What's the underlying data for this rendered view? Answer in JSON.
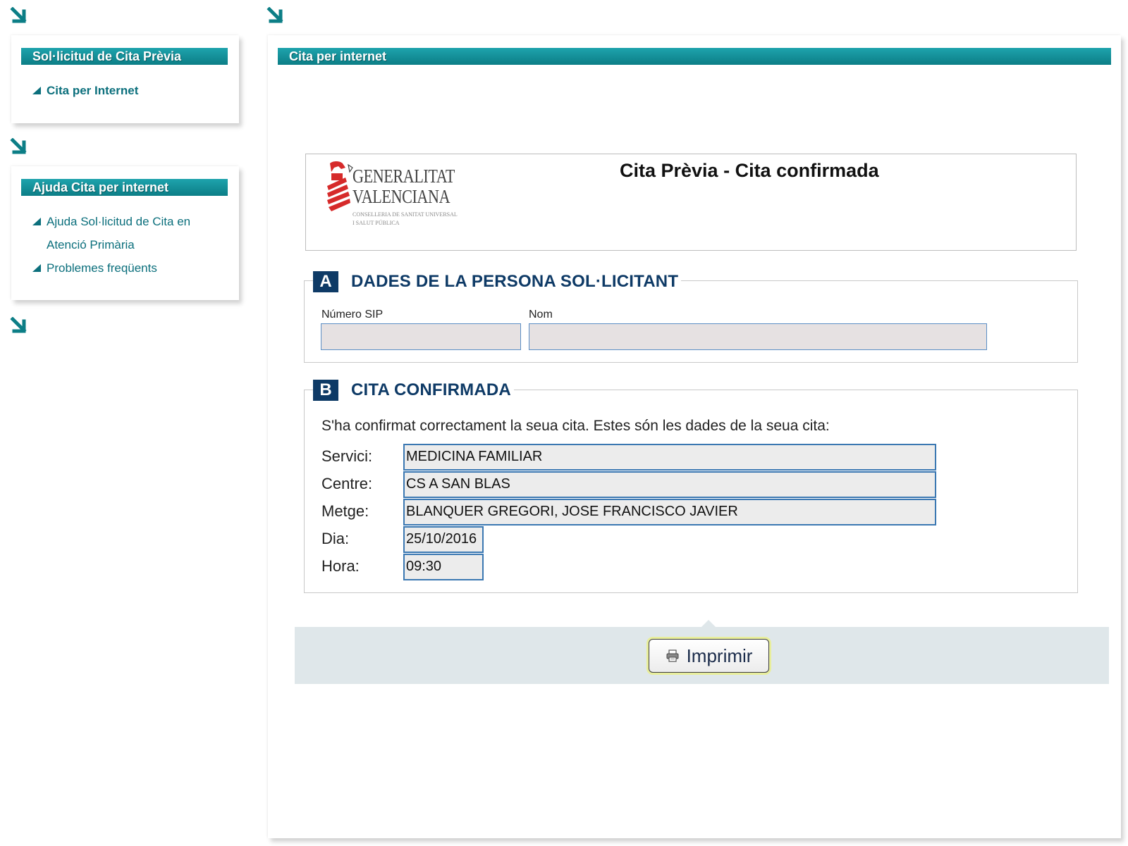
{
  "sidebar": {
    "panel1": {
      "title": "Sol·licitud de Cita Prèvia",
      "items": [
        {
          "label": "Cita per Internet"
        }
      ]
    },
    "panel2": {
      "title": "Ajuda Cita per internet",
      "items": [
        {
          "label_line1": "Ajuda Sol·licitud de Cita en",
          "label_line2": "Atenció Primària"
        },
        {
          "label": "Problemes freqüents"
        }
      ]
    }
  },
  "main": {
    "header_title": "Cita per internet",
    "logo": {
      "line1": "GENERALITAT",
      "line2": "VALENCIANA",
      "sub1": "CONSELLERIA DE SANITAT UNIVERSAL",
      "sub2": "I SALUT PÚBLICA"
    },
    "page_title": "Cita Prèvia - Cita confirmada",
    "section_a": {
      "letter": "A",
      "title": "DADES DE LA PERSONA SOL·LICITANT",
      "sip_label": "Número SIP",
      "sip_value": "",
      "nom_label": "Nom",
      "nom_value": ""
    },
    "section_b": {
      "letter": "B",
      "title": "CITA CONFIRMADA",
      "message": "S'ha confirmat correctament la seua cita. Estes són les dades de la seua cita:",
      "rows": [
        {
          "label": "Servici:",
          "value": "MEDICINA FAMILIAR"
        },
        {
          "label": "Centre:",
          "value": "CS A SAN BLAS"
        },
        {
          "label": "Metge:",
          "value": "BLANQUER GREGORI, JOSE FRANCISCO JAVIER"
        },
        {
          "label": "Dia:",
          "value": "25/10/2016"
        },
        {
          "label": "Hora:",
          "value": "09:30"
        }
      ]
    },
    "print_button": {
      "label": "Imprimir",
      "icon": "printer-icon"
    }
  },
  "colors": {
    "teal": "#0c7e86",
    "navy": "#0e3a66",
    "link": "#0b6f7c",
    "field_border": "#3b78b2"
  }
}
